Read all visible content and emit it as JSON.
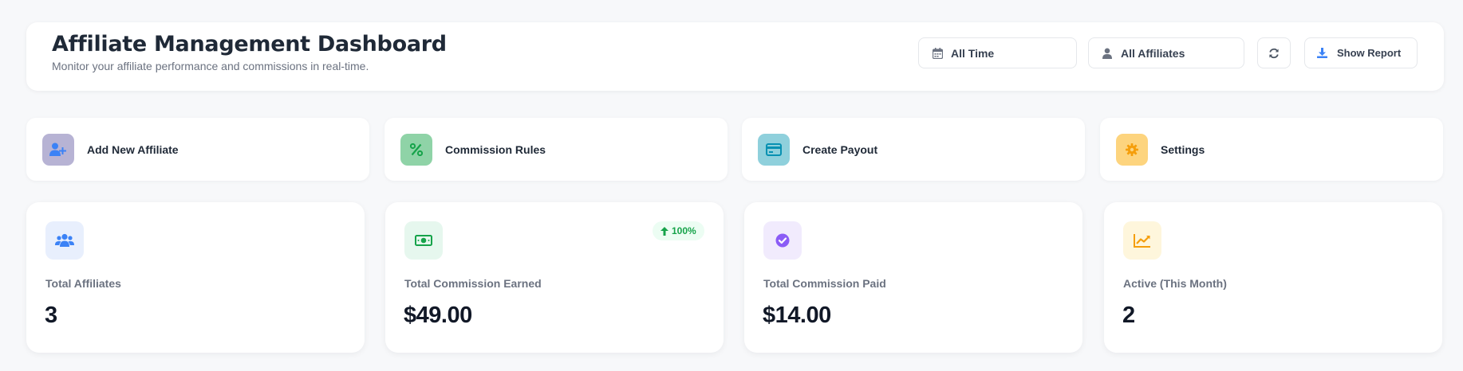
{
  "header": {
    "title": "Affiliate Management Dashboard",
    "subtitle": "Monitor your affiliate performance and commissions in real-time.",
    "date_filter": "All Time",
    "affiliate_filter": "All Affiliates",
    "report_label": "Show Report"
  },
  "actions": [
    {
      "label": "Add New Affiliate",
      "icon": "user-plus-icon",
      "color": "#b7b3d4"
    },
    {
      "label": "Commission Rules",
      "icon": "percent-icon",
      "color": "#8fd3a7"
    },
    {
      "label": "Create Payout",
      "icon": "credit-card-icon",
      "color": "#8fd0dc"
    },
    {
      "label": "Settings",
      "icon": "gear-icon",
      "color": "#fdd47e"
    }
  ],
  "stats": [
    {
      "label": "Total Affiliates",
      "value": "3",
      "icon": "users-icon"
    },
    {
      "label": "Total Commission Earned",
      "value": "$49.00",
      "icon": "money-bill-icon",
      "trend": "100%"
    },
    {
      "label": "Total Commission Paid",
      "value": "$14.00",
      "icon": "check-circle-icon"
    },
    {
      "label": "Active (This Month)",
      "value": "2",
      "icon": "chart-line-icon"
    }
  ],
  "colors": {
    "accent_blue": "#3b82f6",
    "success_green": "#16a34a",
    "purple": "#8b5cf6",
    "amber": "#f59e0b"
  }
}
